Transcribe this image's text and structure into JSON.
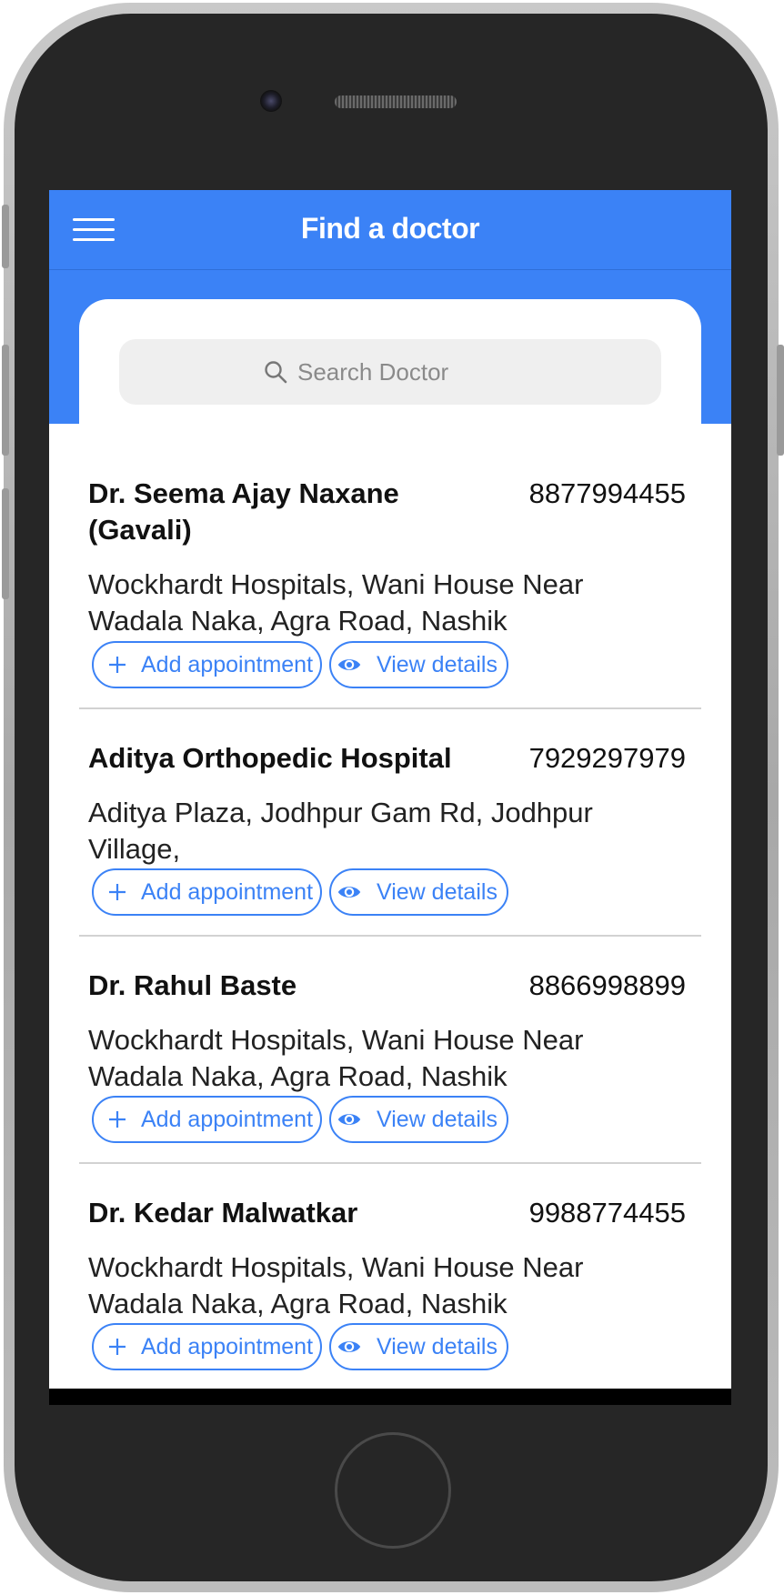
{
  "app": {
    "title": "Find a doctor"
  },
  "search": {
    "placeholder": "Search Doctor"
  },
  "colors": {
    "primary": "#3b82f6",
    "card_divider": "#d2d2d2",
    "search_bg": "#efefef"
  },
  "doctors": [
    {
      "name": "Dr. Seema Ajay Naxane (Gavali)",
      "phone": "8877994455",
      "address": "Wockhardt Hospitals, Wani House Near Wadala Naka, Agra Road, Nashik",
      "add_label": "Add appointment",
      "view_label": "View details"
    },
    {
      "name": "Aditya Orthopedic Hospital",
      "phone": "7929297979",
      "address": "Aditya Plaza, Jodhpur Gam Rd, Jodhpur Village,",
      "add_label": "Add appointment",
      "view_label": "View details"
    },
    {
      "name": "Dr. Rahul Baste",
      "phone": "8866998899",
      "address": "Wockhardt Hospitals, Wani House Near Wadala Naka, Agra Road, Nashik",
      "add_label": "Add appointment",
      "view_label": "View details"
    },
    {
      "name": "Dr. Kedar Malwatkar",
      "phone": "9988774455",
      "address": "Wockhardt Hospitals, Wani House Near Wadala Naka, Agra Road, Nashik",
      "add_label": "Add appointment",
      "view_label": "View details"
    }
  ],
  "icons": {
    "menu": "hamburger-menu-icon",
    "search": "search-icon",
    "add": "plus-icon",
    "view": "eye-icon"
  }
}
